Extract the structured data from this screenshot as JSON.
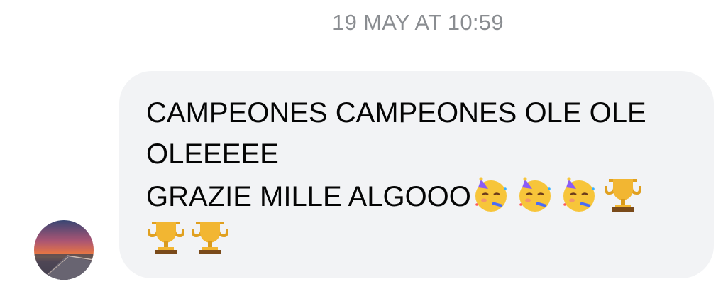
{
  "conversation": {
    "timestamp": "19 MAY AT 10:59",
    "message": {
      "line1": "CAMPEONES CAMPEONES OLE OLE",
      "line2": "OLEEEEE",
      "line3_text": "GRAZIE MILLE ALGOOO",
      "emojis_line3": [
        "partying-face-emoji",
        "partying-face-emoji",
        "partying-face-emoji",
        "trophy-emoji"
      ],
      "emojis_line4": [
        "trophy-emoji",
        "trophy-emoji"
      ]
    },
    "sender_avatar": "sunset-pier-photo"
  },
  "colors": {
    "bubble_background": "#f2f3f5",
    "timestamp_text": "#8a8d91",
    "message_text": "#050505"
  }
}
